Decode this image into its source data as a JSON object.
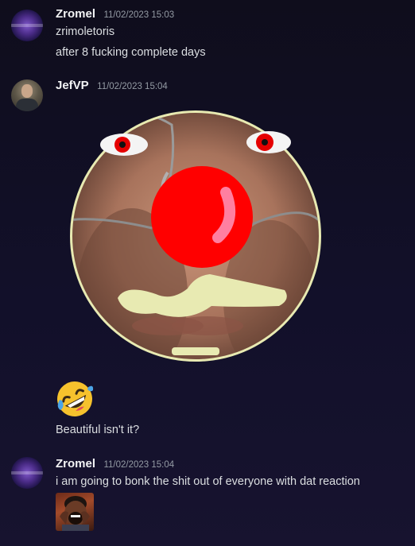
{
  "messages": [
    {
      "username": "Zromel",
      "timestamp": "11/02/2023 15:03",
      "lines": [
        "zrimoletoris",
        "after 8 fucking complete days"
      ]
    },
    {
      "username": "JefVP",
      "timestamp": "11/02/2023 15:04",
      "attachment_icon": "clown-face-drawing",
      "emoji_icon": "rolling-on-floor-laughing-emoji",
      "caption": "Beautiful isn't it?"
    },
    {
      "username": "Zromel",
      "timestamp": "11/02/2023 15:04",
      "lines": [
        "i am going to bonk the shit out of everyone with dat reaction"
      ],
      "attachment_icon": "laughing-man-reaction-image"
    }
  ],
  "colors": {
    "username": "#f2f3f5",
    "timestamp": "#949ba4",
    "text": "#dbdee1",
    "background": "#12102a"
  }
}
